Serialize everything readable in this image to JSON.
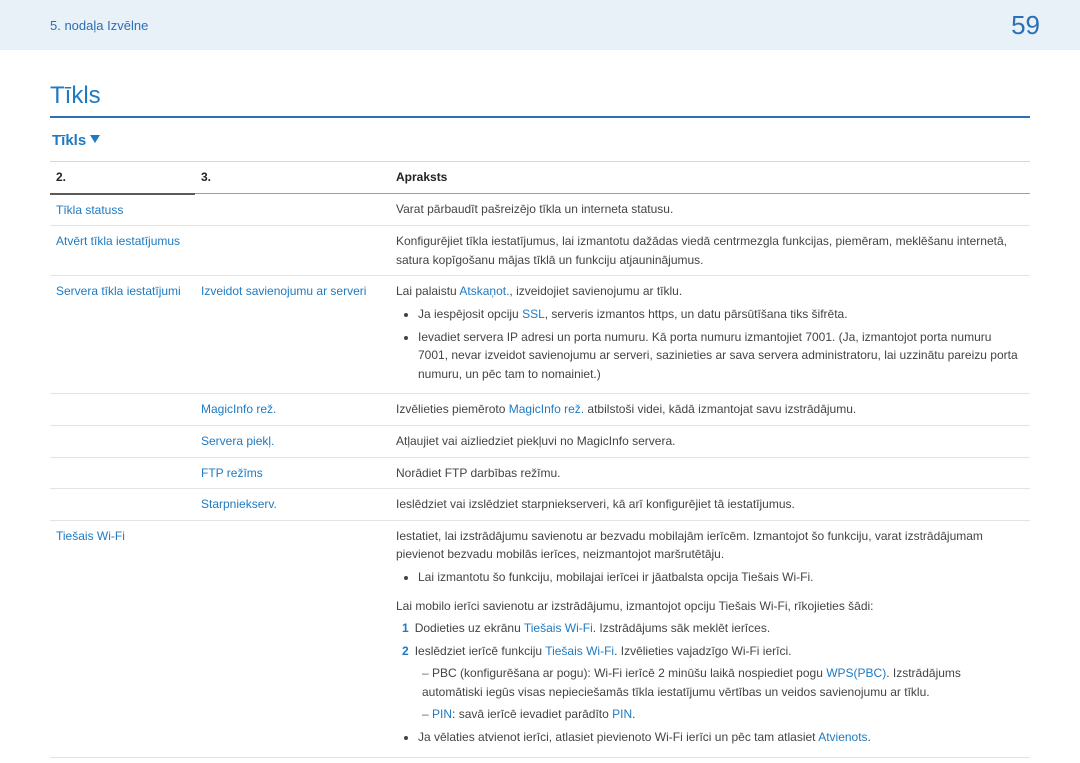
{
  "header": {
    "breadcrumb": "5. nodaļa Izvēlne",
    "page_number": "59"
  },
  "title": "Tīkls",
  "subsection": "Tīkls",
  "table": {
    "h1": "2.",
    "h2": "3.",
    "h3": "Apraksts"
  },
  "rows": {
    "r1_c1": "Tīkla statuss",
    "r1_desc": "Varat pārbaudīt pašreizējo tīkla un interneta statusu.",
    "r2_c1": "Atvērt tīkla iestatījumus",
    "r2_desc": "Konfigurējiet tīkla iestatījumus, lai izmantotu dažādas viedā centrmezgla funkcijas, piemēram, meklēšanu internetā, satura kopīgošanu mājas tīklā un funkciju atjauninājumus.",
    "r3_c1": "Servera tīkla iestatījumi",
    "r3_c2": "Izveidot savienojumu ar serveri",
    "r3_desc_pre": "Lai palaistu ",
    "r3_desc_link": "Atskaņot.",
    "r3_desc_post": ", izveidojiet savienojumu ar tīklu.",
    "r3_b1_pre": "Ja iespējosit opciju ",
    "r3_b1_link": "SSL",
    "r3_b1_post": ", serveris izmantos https, un datu pārsūtīšana tiks šifrēta.",
    "r3_b2": "Ievadiet servera IP adresi un porta numuru. Kā porta numuru izmantojiet 7001. (Ja, izmantojot porta numuru 7001, nevar izveidot savienojumu ar serveri, sazinieties ar sava servera administratoru, lai uzzinātu pareizu porta numuru, un pēc tam to nomainiet.)",
    "r4_c2": "MagicInfo rež.",
    "r4_desc_pre": "Izvēlieties piemēroto ",
    "r4_desc_link": "MagicInfo rež.",
    "r4_desc_post": " atbilstoši videi, kādā izmantojat savu izstrādājumu.",
    "r5_c2": "Servera piekļ.",
    "r5_desc": "Atļaujiet vai aizliedziet piekļuvi no MagicInfo servera.",
    "r6_c2": "FTP režīms",
    "r6_desc": "Norādiet FTP darbības režīmu.",
    "r7_c2": "Starpniekserv.",
    "r7_desc": "Ieslēdziet vai izslēdziet starpniekserveri, kā arī konfigurējiet tā iestatījumus.",
    "r8_c1": "Tiešais Wi-Fi",
    "r8_p1": "Iestatiet, lai izstrādājumu savienotu ar bezvadu mobilajām ierīcēm. Izmantojot šo funkciju, varat izstrādājumam pievienot bezvadu mobilās ierīces, neizmantojot maršrutētāju.",
    "r8_b1": "Lai izmantotu šo funkciju, mobilajai ierīcei ir jāatbalsta opcija Tiešais Wi-Fi.",
    "r8_p2": "Lai mobilo ierīci savienotu ar izstrādājumu, izmantojot opciju Tiešais Wi-Fi, rīkojieties šādi:",
    "r8_s1_pre": "Dodieties uz ekrānu ",
    "r8_s1_link": "Tiešais Wi-Fi",
    "r8_s1_post": ". Izstrādājums sāk meklēt ierīces.",
    "r8_s2_pre": "Ieslēdziet ierīcē funkciju ",
    "r8_s2_link": "Tiešais Wi-Fi",
    "r8_s2_post": ". Izvēlieties vajadzīgo Wi-Fi ierīci.",
    "r8_d1_pre": "PBC (konfigurēšana ar pogu): Wi-Fi ierīcē 2 minūšu laikā nospiediet pogu ",
    "r8_d1_link": "WPS(PBC)",
    "r8_d1_post": ". Izstrādājums automātiski iegūs visas nepieciešamās tīkla iestatījumu vērtības un veidos savienojumu ar tīklu.",
    "r8_d2_pre": "PIN",
    "r8_d2_mid": ": savā ierīcē ievadiet parādīto ",
    "r8_d2_link": "PIN",
    "r8_d2_post": ".",
    "r8_b2_pre": "Ja vēlaties atvienot ierīci, atlasiet pievienoto Wi-Fi ierīci un pēc tam atlasiet ",
    "r8_b2_link": "Atvienots",
    "r8_b2_post": "."
  }
}
